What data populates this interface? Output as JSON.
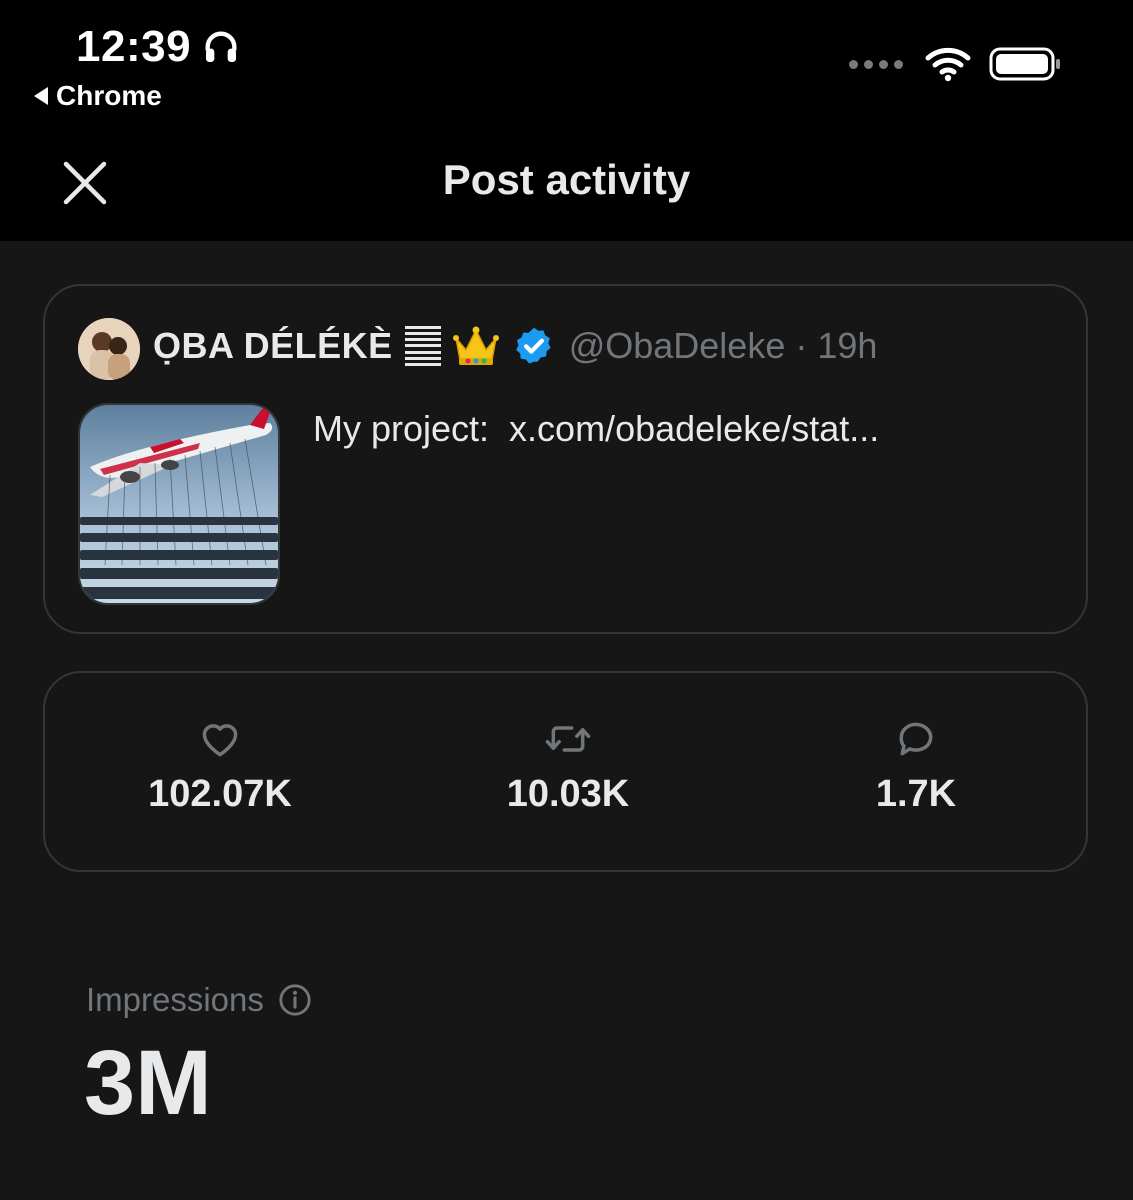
{
  "status_bar": {
    "time": "12:39",
    "back_app": "Chrome",
    "icons": [
      "headphones-icon",
      "signal-dots-icon",
      "wifi-icon",
      "battery-icon"
    ]
  },
  "header": {
    "title": "Post activity",
    "close_icon": "close-icon"
  },
  "post": {
    "display_name": "ỌBA DÉLÉKÈ",
    "handle_time": "@ObaDeleke · 19h",
    "text": "My project:  x.com/obadeleke/stat...",
    "badges": [
      "flag-lines-icon",
      "crown-icon",
      "verified-icon"
    ],
    "thumbnail": "airplane-image"
  },
  "metrics": {
    "likes": "102.07K",
    "reposts": "10.03K",
    "replies": "1.7K"
  },
  "impressions": {
    "label": "Impressions",
    "value": "3M"
  },
  "colors": {
    "header_bg": "#000000",
    "content_bg": "#161616",
    "card_border": "#333639",
    "primary_text": "#e7e9ea",
    "secondary_text": "#71767b",
    "verified_blue": "#1d9bf0"
  }
}
